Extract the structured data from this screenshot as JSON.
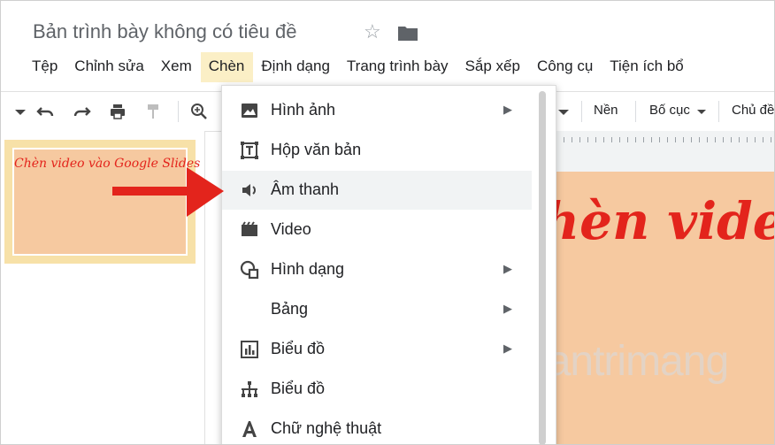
{
  "app": {
    "doc_title": "Bản trình bày không có tiêu đề",
    "icons": [
      "star-icon",
      "folder-icon"
    ]
  },
  "menubar": {
    "items": [
      "Tệp",
      "Chỉnh sửa",
      "Xem",
      "Chèn",
      "Định dạng",
      "Trang trình bày",
      "Sắp xếp",
      "Công cụ",
      "Tiện ích bổ"
    ],
    "active": "Chèn"
  },
  "toolbar": {
    "background_label": "Nền",
    "layout_label": "Bố cục",
    "theme_label": "Chủ đề"
  },
  "filmstrip": {
    "slide1_text": "Chèn video vào Google Slides"
  },
  "slide": {
    "title_text": "hèn video"
  },
  "insert_menu": {
    "items": [
      {
        "label": "Hình ảnh",
        "icon": "image-icon",
        "submenu": true
      },
      {
        "label": "Hộp văn bản",
        "icon": "text-box-icon",
        "submenu": false
      },
      {
        "label": "Âm thanh",
        "icon": "audio-icon",
        "submenu": false,
        "highlighted": true
      },
      {
        "label": "Video",
        "icon": "video-icon",
        "submenu": false
      },
      {
        "label": "Hình dạng",
        "icon": "shape-icon",
        "submenu": true
      },
      {
        "label": "Bảng",
        "icon": "",
        "submenu": true
      },
      {
        "label": "Biểu đồ",
        "icon": "chart-icon",
        "submenu": true
      },
      {
        "label": "Biểu đồ",
        "icon": "diagram-icon",
        "submenu": false
      },
      {
        "label": "Chữ nghệ thuật",
        "icon": "word-art-icon",
        "submenu": false
      }
    ]
  },
  "watermark": {
    "text": "uantrimang"
  },
  "colors": {
    "accent_red": "#e3241c",
    "slide_fill": "#f6c9a0",
    "menu_active": "#fbefc6"
  }
}
